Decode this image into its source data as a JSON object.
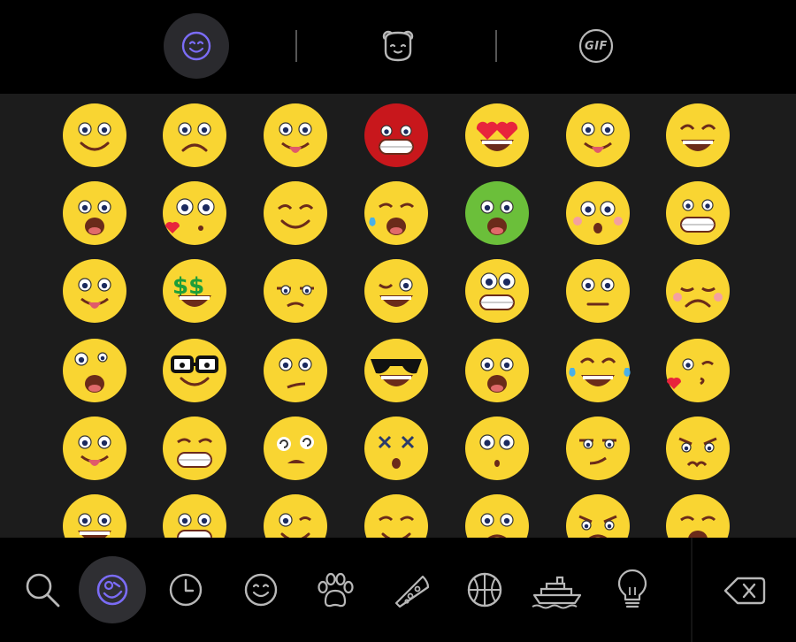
{
  "theme": {
    "background": "#000000",
    "grid_background": "#1c1c1c",
    "accent": "#7b6cf6",
    "icon_color": "#b8b8b8",
    "emoji_yellow": "#f9d532"
  },
  "top_tabs": [
    {
      "name": "emoji",
      "icon": "smiley-icon",
      "active": true
    },
    {
      "name": "stickers",
      "icon": "bear-face-icon",
      "active": false
    },
    {
      "name": "gif",
      "icon": "gif-icon",
      "label": "GIF",
      "active": false
    }
  ],
  "emoji_grid": {
    "columns": 7,
    "rows": [
      [
        "smiling-face",
        "worried-face",
        "winking-tongue-face",
        "angry-red-face",
        "heart-eyes-face",
        "tongue-out-face",
        "grinning-squint-face"
      ],
      [
        "astonished-face",
        "flirty-kiss-face",
        "content-smile-face",
        "crying-face",
        "nauseated-green-face",
        "pleading-blush-face",
        "big-grin-face"
      ],
      [
        "tongue-frown-face",
        "money-eyes-face",
        "skeptical-face",
        "winking-laugh-face",
        "goofy-face",
        "neutral-face",
        "pensive-face"
      ],
      [
        "crazy-face",
        "nerd-glasses-face",
        "confused-face",
        "cool-sunglasses-face",
        "surprised-face",
        "tears-of-joy-face",
        "kissing-heart-face"
      ],
      [
        "drooling-tongue-face",
        "grimacing-face",
        "dizzy-face",
        "knocked-out-face",
        "staring-face",
        "smirking-face",
        "annoyed-face"
      ],
      [
        "smiling-face-partial",
        "happy-face-partial",
        "winking-face-partial",
        "relieved-face-partial",
        "sad-face-partial",
        "angry-face-partial",
        "upset-face-partial"
      ]
    ]
  },
  "bottom_categories": [
    {
      "name": "search",
      "icon": "search-icon",
      "active": false
    },
    {
      "name": "smileys",
      "icon": "smileys-category-icon",
      "active": true
    },
    {
      "name": "recent",
      "icon": "clock-icon",
      "active": false
    },
    {
      "name": "people",
      "icon": "smiley-outline-icon",
      "active": false
    },
    {
      "name": "animals",
      "icon": "paw-icon",
      "active": false
    },
    {
      "name": "food",
      "icon": "pizza-icon",
      "active": false
    },
    {
      "name": "activities",
      "icon": "basketball-icon",
      "active": false
    },
    {
      "name": "travel",
      "icon": "ship-icon",
      "active": false
    },
    {
      "name": "objects",
      "icon": "lightbulb-icon",
      "active": false
    }
  ],
  "backspace": {
    "icon": "backspace-icon"
  }
}
